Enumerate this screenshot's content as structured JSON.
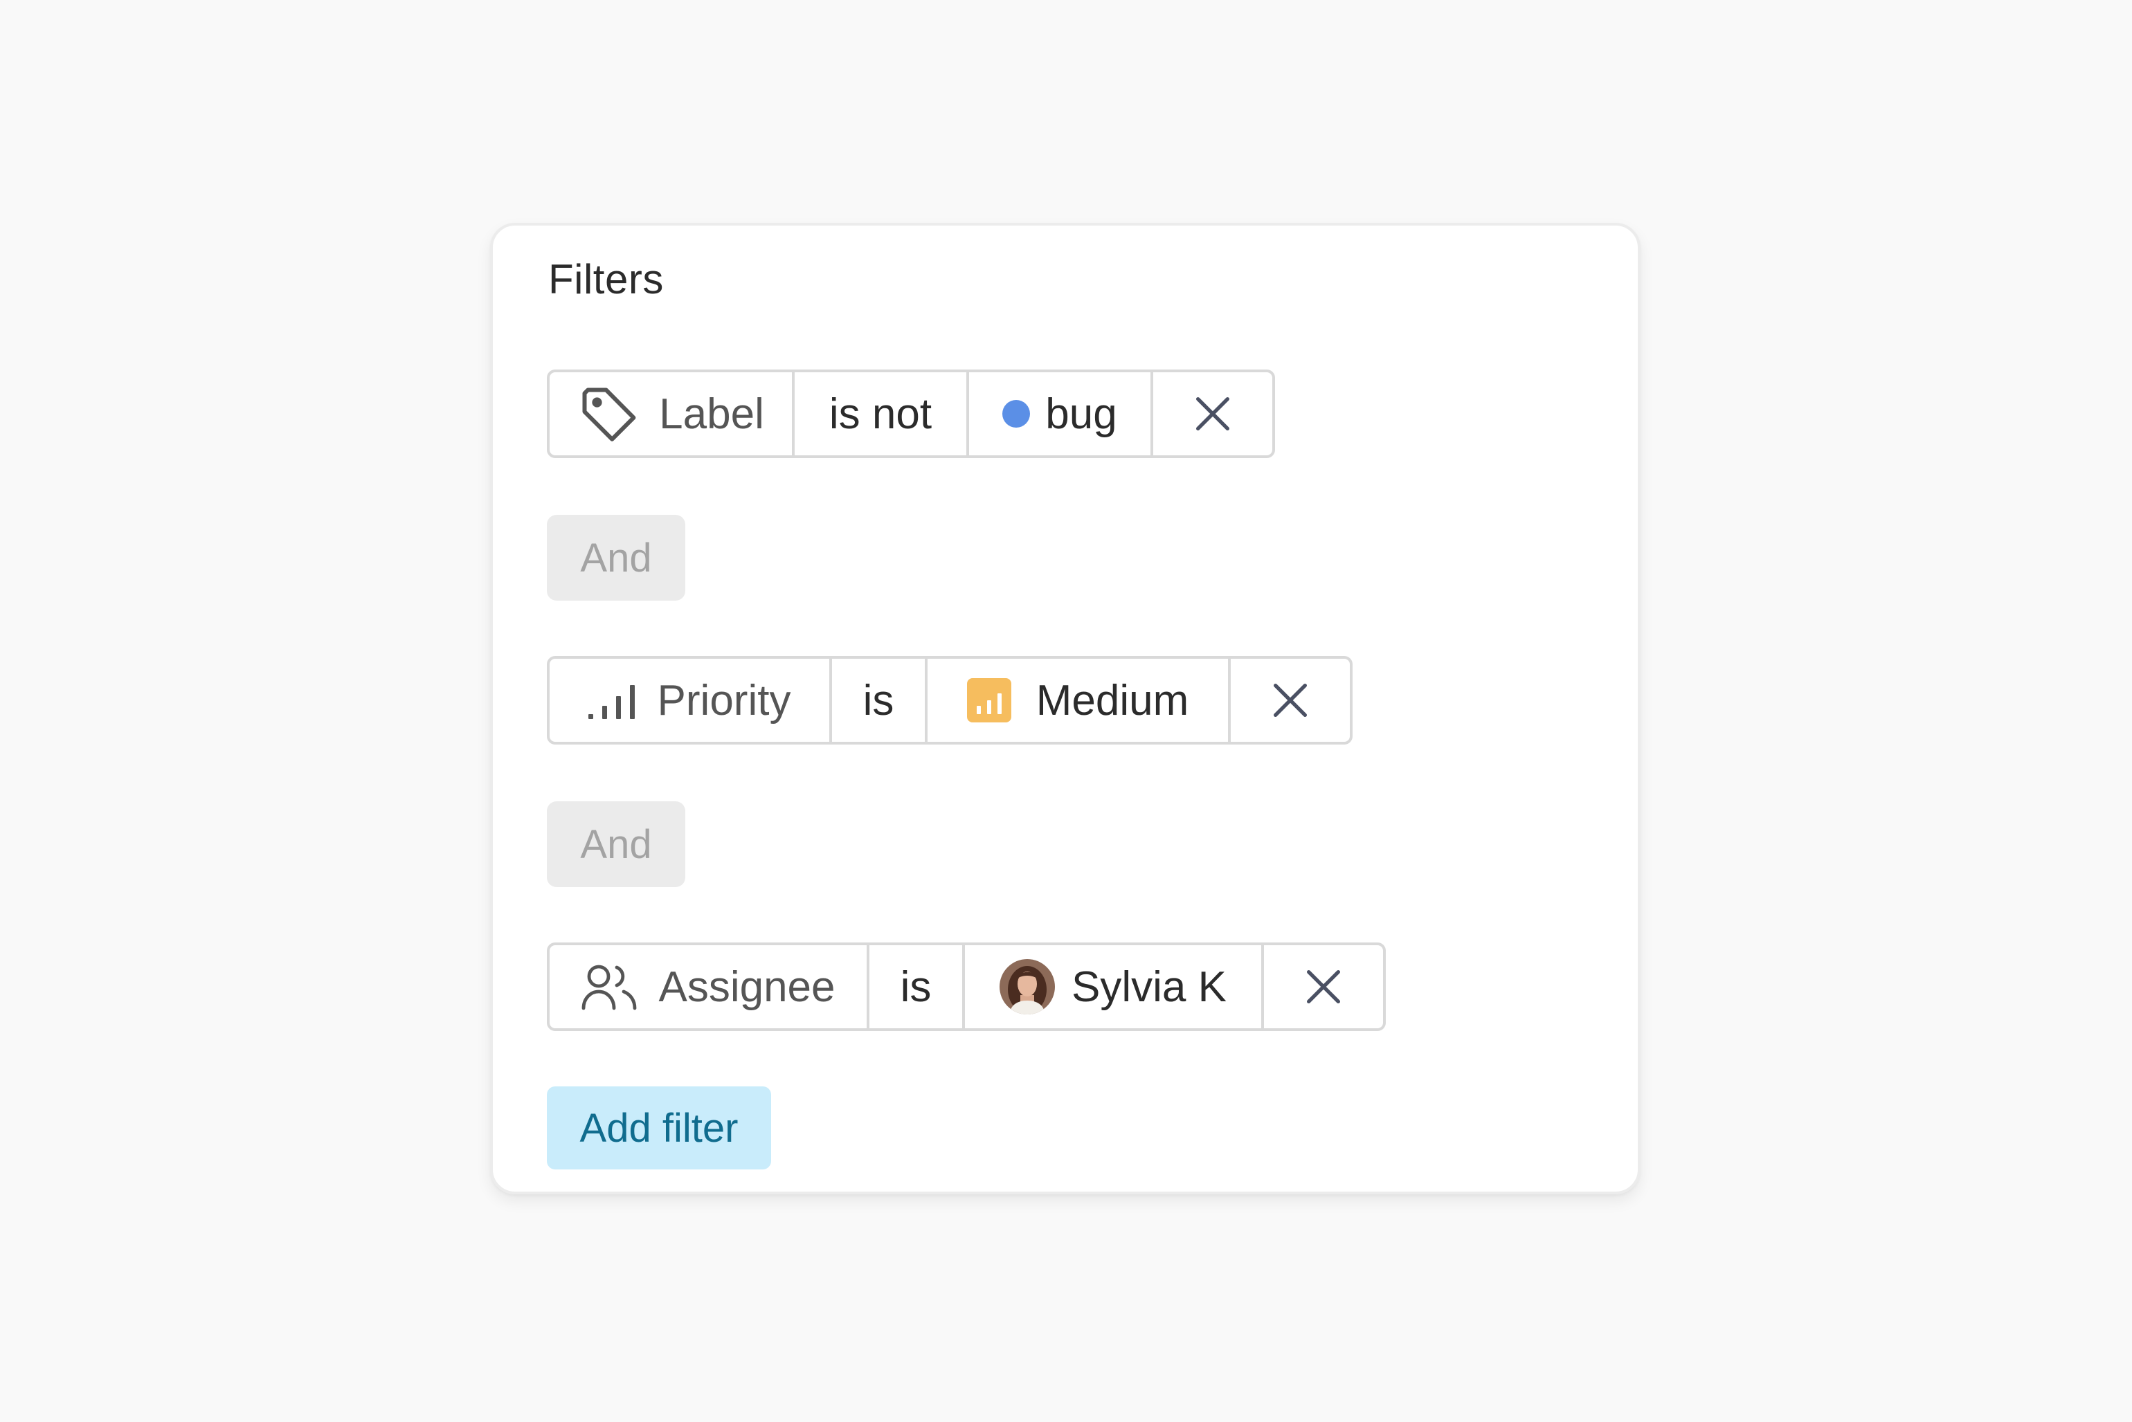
{
  "panel": {
    "title": "Filters",
    "connector_label": "And",
    "add_filter_label": "Add filter"
  },
  "filters": [
    {
      "field": "Label",
      "field_icon": "tag-icon",
      "operator": "is not",
      "value": "bug",
      "value_icon": "dot-icon",
      "value_color": "#5b8fe6"
    },
    {
      "field": "Priority",
      "field_icon": "signal-bars-icon",
      "operator": "is",
      "value": "Medium",
      "value_icon": "priority-medium-icon",
      "value_color": "#f6bd5e"
    },
    {
      "field": "Assignee",
      "field_icon": "users-icon",
      "operator": "is",
      "value": "Sylvia K",
      "value_icon": "avatar"
    }
  ],
  "colors": {
    "page_background": "#f9f9f9",
    "card_background": "#ffffff",
    "chip_border": "#d9d9d9",
    "and_background": "#ebebeb",
    "and_text": "#a3a3a3",
    "add_background": "#c9ecfb",
    "add_text": "#106c8e",
    "close_icon": "#4a5063"
  }
}
